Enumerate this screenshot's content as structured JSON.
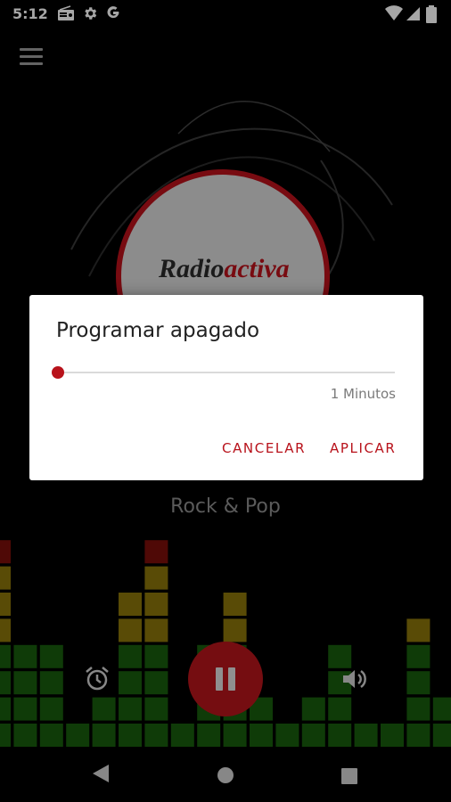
{
  "status_bar": {
    "time": "5:12",
    "icons": [
      "radio-icon",
      "gear-icon",
      "google-g-icon",
      "wifi-icon",
      "signal-icon",
      "battery-icon"
    ]
  },
  "header": {
    "menu_icon": "hamburger-menu-icon"
  },
  "logo": {
    "text_part1": "Radio",
    "text_part2": "activa"
  },
  "station": {
    "name": "Rock & Pop"
  },
  "player": {
    "alarm_icon": "alarm-icon",
    "play_state_icon": "pause-icon",
    "volume_icon": "volume-icon"
  },
  "dialog": {
    "title": "Programar apagado",
    "slider_value_fraction": 0.0,
    "value_label": "1 Minutos",
    "cancel_label": "CANCELAR",
    "apply_label": "APLICAR"
  },
  "navbar": {
    "icons": [
      "back-icon",
      "home-icon",
      "recents-icon"
    ]
  },
  "colors": {
    "accent": "#b8121b",
    "eq_green": "#1f7a12",
    "eq_yellow": "#b79a0e",
    "eq_red": "#a3130e"
  },
  "equalizer": {
    "levels": [
      8,
      4,
      4,
      1,
      2,
      6,
      8,
      1,
      4,
      6,
      2,
      1,
      2,
      4,
      1,
      1,
      5,
      2,
      8
    ]
  }
}
